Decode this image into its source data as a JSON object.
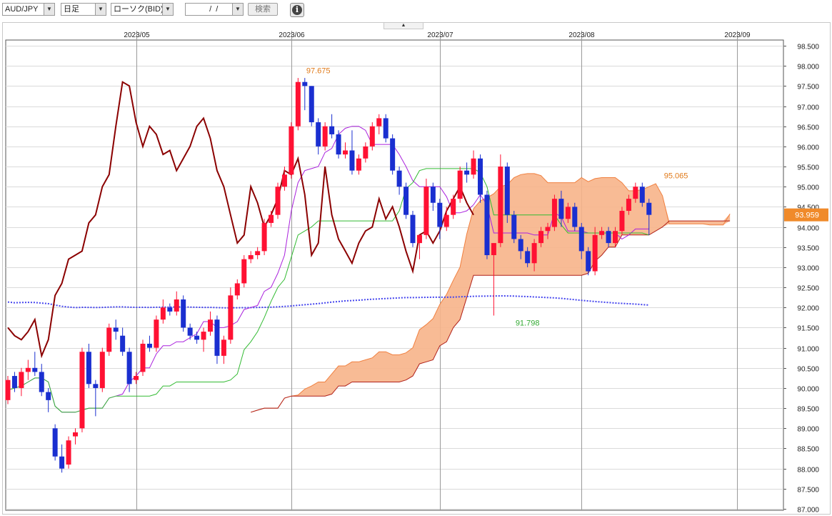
{
  "toolbar": {
    "pair": "AUD/JPY",
    "timeframe": "日足",
    "chart_type": "ローソク(BID)",
    "date_value": "  /  /",
    "search_label": "検索",
    "info_glyph": "i"
  },
  "chart_data": {
    "type": "candlestick",
    "symbol": "AUD/JPY",
    "title": "",
    "ylim": [
      87.0,
      98.5
    ],
    "y_ticks": [
      "98.500",
      "98.000",
      "97.500",
      "97.000",
      "96.500",
      "96.000",
      "95.500",
      "95.000",
      "94.500",
      "94.000",
      "93.500",
      "93.000",
      "92.500",
      "92.000",
      "91.500",
      "91.000",
      "90.500",
      "90.000",
      "89.500",
      "89.000",
      "88.500",
      "88.000",
      "87.500",
      "87.000"
    ],
    "x_labels": [
      "2023/05",
      "2023/06",
      "2023/07",
      "2023/08",
      "2023/09"
    ],
    "x_label_index": [
      19,
      42,
      64,
      85,
      108
    ],
    "current_price": "93.959",
    "annotations": [
      {
        "text": "97.675",
        "bar": 46,
        "price": 97.675,
        "color": "#e07a1a"
      },
      {
        "text": "91.798",
        "bar": 77,
        "price": 91.798,
        "color": "#33aa33"
      },
      {
        "text": "95.065",
        "bar": 99,
        "price": 95.065,
        "color": "#e07a1a"
      }
    ],
    "colors": {
      "up": "#ff1133",
      "down": "#1a2fd0",
      "cloud": "#f7b48a",
      "cloud_edge": "#b0201a",
      "lagging": "#8b0000",
      "base": "#33bb33",
      "conversion": "#aa22dd",
      "ma200": "#4444ee",
      "spanB_future": "#f08040"
    },
    "candles": [
      [
        89.7,
        90.3,
        89.6,
        90.2
      ],
      [
        90.3,
        90.4,
        89.9,
        90.0
      ],
      [
        90.0,
        90.5,
        89.8,
        90.4
      ],
      [
        90.4,
        90.7,
        90.2,
        90.5
      ],
      [
        90.5,
        90.9,
        90.3,
        90.4
      ],
      [
        90.4,
        90.6,
        89.8,
        89.9
      ],
      [
        89.9,
        90.0,
        89.4,
        89.7
      ],
      [
        89.0,
        89.1,
        88.2,
        88.3
      ],
      [
        88.3,
        88.6,
        87.9,
        88.0
      ],
      [
        88.1,
        88.8,
        88.0,
        88.7
      ],
      [
        88.8,
        89.0,
        88.6,
        88.9
      ],
      [
        89.0,
        91.0,
        88.9,
        90.9
      ],
      [
        90.9,
        91.1,
        90.0,
        90.1
      ],
      [
        90.1,
        90.2,
        89.3,
        90.0
      ],
      [
        90.0,
        91.0,
        89.9,
        90.9
      ],
      [
        90.9,
        91.6,
        90.8,
        91.5
      ],
      [
        91.5,
        91.7,
        91.2,
        91.4
      ],
      [
        91.3,
        91.5,
        90.8,
        90.9
      ],
      [
        90.9,
        91.0,
        89.9,
        90.1
      ],
      [
        90.2,
        90.4,
        90.1,
        90.3
      ],
      [
        90.4,
        91.2,
        90.3,
        91.1
      ],
      [
        91.1,
        91.3,
        90.9,
        91.0
      ],
      [
        91.0,
        91.8,
        90.9,
        91.7
      ],
      [
        91.7,
        92.2,
        91.6,
        92.0
      ],
      [
        92.0,
        92.1,
        91.8,
        91.9
      ],
      [
        91.9,
        92.4,
        91.8,
        92.2
      ],
      [
        92.2,
        92.3,
        91.4,
        91.5
      ],
      [
        91.5,
        91.6,
        91.2,
        91.3
      ],
      [
        91.3,
        91.4,
        91.1,
        91.2
      ],
      [
        91.2,
        91.5,
        90.9,
        91.4
      ],
      [
        91.4,
        91.9,
        91.3,
        91.7
      ],
      [
        91.7,
        91.8,
        90.6,
        90.8
      ],
      [
        90.8,
        91.3,
        90.6,
        91.2
      ],
      [
        91.2,
        92.5,
        91.1,
        92.3
      ],
      [
        92.3,
        92.7,
        92.2,
        92.6
      ],
      [
        92.6,
        93.3,
        92.5,
        93.2
      ],
      [
        93.2,
        93.4,
        93.1,
        93.3
      ],
      [
        93.3,
        93.5,
        93.2,
        93.4
      ],
      [
        93.4,
        94.2,
        93.3,
        94.1
      ],
      [
        94.1,
        94.4,
        94.0,
        94.3
      ],
      [
        94.3,
        95.1,
        94.2,
        95.0
      ],
      [
        95.0,
        95.5,
        94.9,
        95.3
      ],
      [
        95.3,
        96.6,
        95.2,
        96.5
      ],
      [
        96.5,
        97.7,
        96.4,
        97.6
      ],
      [
        97.6,
        97.7,
        96.9,
        97.5
      ],
      [
        97.5,
        97.5,
        96.5,
        96.6
      ],
      [
        96.6,
        96.7,
        95.8,
        96.0
      ],
      [
        96.0,
        96.6,
        95.9,
        96.5
      ],
      [
        96.5,
        96.8,
        96.2,
        96.3
      ],
      [
        96.3,
        96.4,
        95.7,
        95.8
      ],
      [
        95.8,
        96.1,
        95.7,
        95.9
      ],
      [
        95.9,
        96.4,
        95.3,
        95.4
      ],
      [
        95.4,
        95.8,
        95.3,
        95.7
      ],
      [
        95.7,
        96.1,
        95.6,
        96.0
      ],
      [
        96.0,
        96.6,
        95.9,
        96.5
      ],
      [
        96.5,
        96.8,
        96.3,
        96.7
      ],
      [
        96.7,
        96.8,
        96.1,
        96.2
      ],
      [
        96.2,
        96.3,
        95.3,
        95.4
      ],
      [
        95.4,
        95.5,
        94.8,
        95.0
      ],
      [
        95.0,
        95.1,
        94.2,
        94.3
      ],
      [
        94.3,
        94.4,
        93.5,
        93.6
      ],
      [
        93.6,
        93.8,
        93.2,
        93.8
      ],
      [
        93.8,
        95.2,
        93.7,
        95.0
      ],
      [
        95.0,
        95.1,
        94.4,
        94.6
      ],
      [
        94.6,
        94.7,
        93.7,
        94.0
      ],
      [
        94.0,
        94.5,
        93.9,
        94.3
      ],
      [
        94.3,
        94.8,
        94.2,
        94.7
      ],
      [
        94.7,
        95.5,
        94.6,
        95.4
      ],
      [
        95.4,
        95.6,
        95.1,
        95.3
      ],
      [
        95.3,
        95.9,
        95.2,
        95.7
      ],
      [
        95.7,
        95.8,
        94.6,
        94.8
      ],
      [
        94.8,
        94.9,
        93.2,
        93.3
      ],
      [
        93.3,
        93.6,
        91.8,
        93.6
      ],
      [
        93.6,
        95.8,
        93.5,
        95.5
      ],
      [
        95.5,
        95.6,
        94.1,
        94.3
      ],
      [
        94.3,
        94.4,
        93.6,
        93.7
      ],
      [
        93.7,
        93.8,
        93.2,
        93.4
      ],
      [
        93.4,
        93.5,
        93.0,
        93.1
      ],
      [
        93.1,
        93.7,
        92.9,
        93.6
      ],
      [
        93.6,
        94.0,
        93.5,
        93.9
      ],
      [
        93.9,
        94.1,
        93.7,
        94.0
      ],
      [
        94.0,
        94.8,
        93.9,
        94.7
      ],
      [
        94.7,
        94.9,
        94.0,
        94.2
      ],
      [
        94.2,
        94.6,
        94.1,
        94.5
      ],
      [
        94.5,
        94.6,
        93.9,
        94.0
      ],
      [
        94.0,
        94.1,
        93.2,
        93.4
      ],
      [
        93.4,
        93.5,
        92.8,
        92.9
      ],
      [
        92.9,
        94.0,
        92.8,
        93.8
      ],
      [
        93.8,
        94.0,
        93.7,
        93.9
      ],
      [
        93.9,
        94.0,
        93.5,
        93.6
      ],
      [
        93.6,
        94.0,
        93.5,
        93.9
      ],
      [
        93.9,
        94.5,
        93.8,
        94.4
      ],
      [
        94.4,
        94.8,
        94.3,
        94.7
      ],
      [
        94.7,
        95.1,
        94.6,
        95.0
      ],
      [
        95.0,
        95.1,
        94.5,
        94.6
      ],
      [
        94.6,
        94.7,
        93.8,
        94.3
      ]
    ]
  }
}
